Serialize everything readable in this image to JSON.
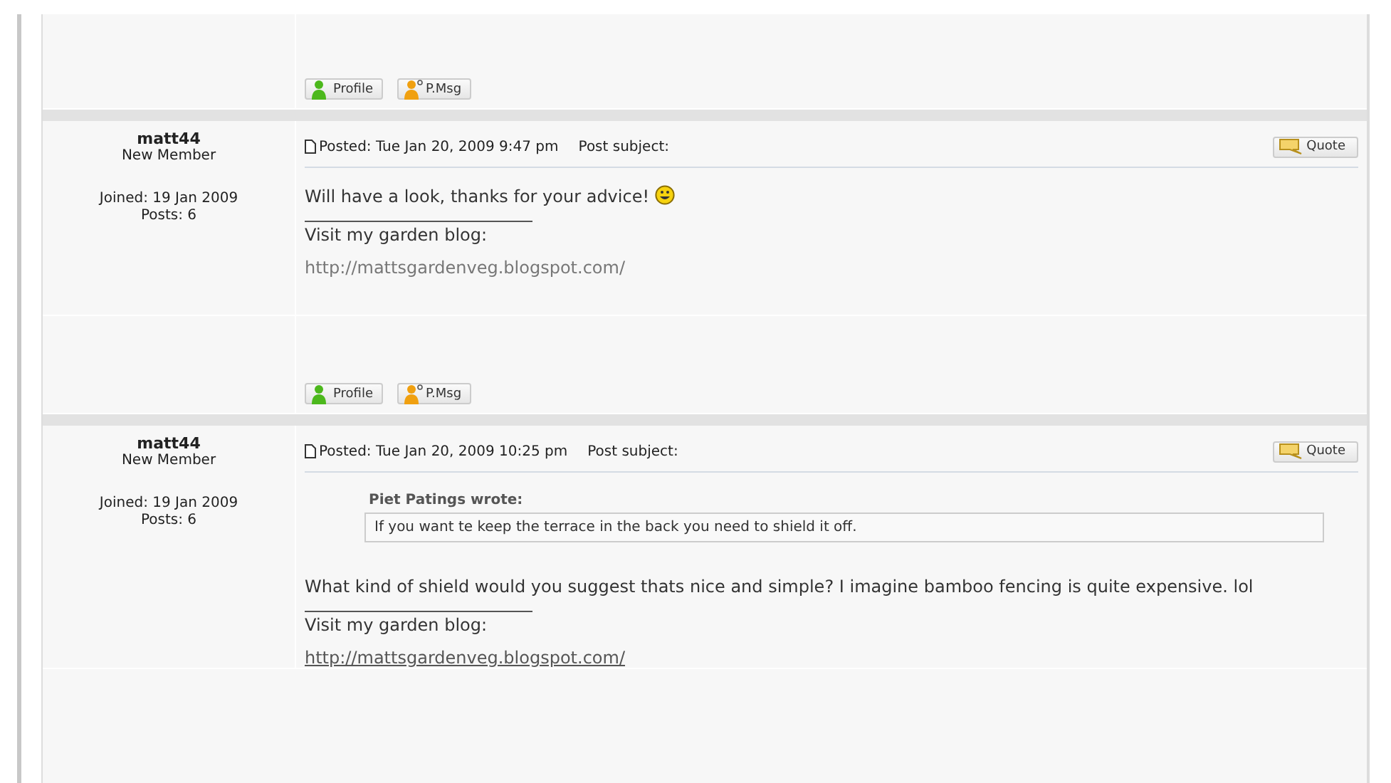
{
  "previous_post_footer": {
    "buttons": [
      {
        "kind": "profile",
        "label": "Profile"
      },
      {
        "kind": "message",
        "label": "P.Msg"
      }
    ]
  },
  "posts": [
    {
      "author": "matt44",
      "rank": "New Member",
      "joined": "Joined: 19 Jan 2009",
      "post_count": "Posts: 6",
      "posted": "Posted: Tue Jan 20, 2009 9:47 pm",
      "subject_label": "Post subject:",
      "quote_button": "Quote",
      "body": "Will have a look, thanks for your advice!",
      "smiley": true,
      "signature": "Visit my garden blog:",
      "link": {
        "text": "http://mattsgardenveg.blogspot.com/",
        "visited": true
      },
      "buttons": [
        {
          "kind": "profile",
          "label": "Profile"
        },
        {
          "kind": "message",
          "label": "P.Msg"
        }
      ]
    },
    {
      "author": "matt44",
      "rank": "New Member",
      "joined": "Joined: 19 Jan 2009",
      "post_count": "Posts: 6",
      "posted": "Posted: Tue Jan 20, 2009 10:25 pm",
      "subject_label": "Post subject:",
      "quote_button": "Quote",
      "quote": {
        "header": "Piet Patings wrote:",
        "text": "If you want te keep the terrace in the back you need to shield it off."
      },
      "body": "What kind of shield would you suggest thats nice and simple? I imagine bamboo fencing is quite expensive. lol",
      "smiley": false,
      "signature": "Visit my garden blog:",
      "link": {
        "text": "http://mattsgardenveg.blogspot.com/",
        "visited": false
      }
    }
  ]
}
